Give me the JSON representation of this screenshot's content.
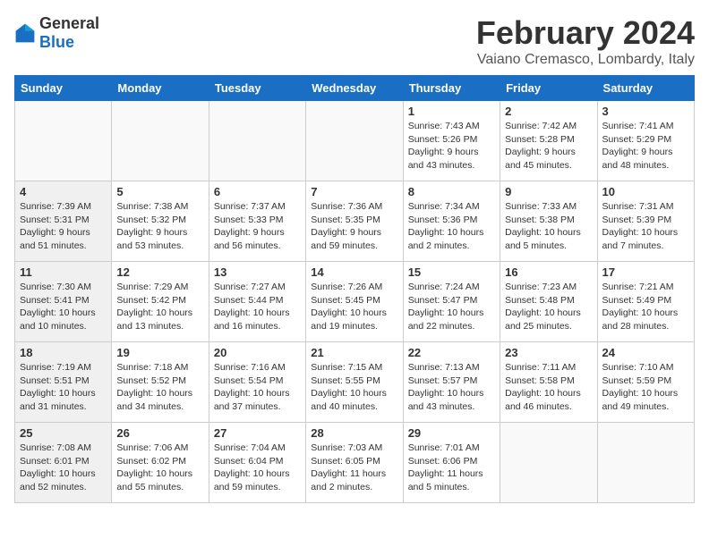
{
  "logo": {
    "text_general": "General",
    "text_blue": "Blue"
  },
  "header": {
    "title": "February 2024",
    "subtitle": "Vaiano Cremasco, Lombardy, Italy"
  },
  "weekdays": [
    "Sunday",
    "Monday",
    "Tuesday",
    "Wednesday",
    "Thursday",
    "Friday",
    "Saturday"
  ],
  "weeks": [
    [
      {
        "day": "",
        "info": "",
        "empty": true
      },
      {
        "day": "",
        "info": "",
        "empty": true
      },
      {
        "day": "",
        "info": "",
        "empty": true
      },
      {
        "day": "",
        "info": "",
        "empty": true
      },
      {
        "day": "1",
        "info": "Sunrise: 7:43 AM\nSunset: 5:26 PM\nDaylight: 9 hours\nand 43 minutes."
      },
      {
        "day": "2",
        "info": "Sunrise: 7:42 AM\nSunset: 5:28 PM\nDaylight: 9 hours\nand 45 minutes."
      },
      {
        "day": "3",
        "info": "Sunrise: 7:41 AM\nSunset: 5:29 PM\nDaylight: 9 hours\nand 48 minutes."
      }
    ],
    [
      {
        "day": "4",
        "info": "Sunrise: 7:39 AM\nSunset: 5:31 PM\nDaylight: 9 hours\nand 51 minutes.",
        "shaded": true
      },
      {
        "day": "5",
        "info": "Sunrise: 7:38 AM\nSunset: 5:32 PM\nDaylight: 9 hours\nand 53 minutes."
      },
      {
        "day": "6",
        "info": "Sunrise: 7:37 AM\nSunset: 5:33 PM\nDaylight: 9 hours\nand 56 minutes."
      },
      {
        "day": "7",
        "info": "Sunrise: 7:36 AM\nSunset: 5:35 PM\nDaylight: 9 hours\nand 59 minutes."
      },
      {
        "day": "8",
        "info": "Sunrise: 7:34 AM\nSunset: 5:36 PM\nDaylight: 10 hours\nand 2 minutes."
      },
      {
        "day": "9",
        "info": "Sunrise: 7:33 AM\nSunset: 5:38 PM\nDaylight: 10 hours\nand 5 minutes."
      },
      {
        "day": "10",
        "info": "Sunrise: 7:31 AM\nSunset: 5:39 PM\nDaylight: 10 hours\nand 7 minutes."
      }
    ],
    [
      {
        "day": "11",
        "info": "Sunrise: 7:30 AM\nSunset: 5:41 PM\nDaylight: 10 hours\nand 10 minutes.",
        "shaded": true
      },
      {
        "day": "12",
        "info": "Sunrise: 7:29 AM\nSunset: 5:42 PM\nDaylight: 10 hours\nand 13 minutes."
      },
      {
        "day": "13",
        "info": "Sunrise: 7:27 AM\nSunset: 5:44 PM\nDaylight: 10 hours\nand 16 minutes."
      },
      {
        "day": "14",
        "info": "Sunrise: 7:26 AM\nSunset: 5:45 PM\nDaylight: 10 hours\nand 19 minutes."
      },
      {
        "day": "15",
        "info": "Sunrise: 7:24 AM\nSunset: 5:47 PM\nDaylight: 10 hours\nand 22 minutes."
      },
      {
        "day": "16",
        "info": "Sunrise: 7:23 AM\nSunset: 5:48 PM\nDaylight: 10 hours\nand 25 minutes."
      },
      {
        "day": "17",
        "info": "Sunrise: 7:21 AM\nSunset: 5:49 PM\nDaylight: 10 hours\nand 28 minutes."
      }
    ],
    [
      {
        "day": "18",
        "info": "Sunrise: 7:19 AM\nSunset: 5:51 PM\nDaylight: 10 hours\nand 31 minutes.",
        "shaded": true
      },
      {
        "day": "19",
        "info": "Sunrise: 7:18 AM\nSunset: 5:52 PM\nDaylight: 10 hours\nand 34 minutes."
      },
      {
        "day": "20",
        "info": "Sunrise: 7:16 AM\nSunset: 5:54 PM\nDaylight: 10 hours\nand 37 minutes."
      },
      {
        "day": "21",
        "info": "Sunrise: 7:15 AM\nSunset: 5:55 PM\nDaylight: 10 hours\nand 40 minutes."
      },
      {
        "day": "22",
        "info": "Sunrise: 7:13 AM\nSunset: 5:57 PM\nDaylight: 10 hours\nand 43 minutes."
      },
      {
        "day": "23",
        "info": "Sunrise: 7:11 AM\nSunset: 5:58 PM\nDaylight: 10 hours\nand 46 minutes."
      },
      {
        "day": "24",
        "info": "Sunrise: 7:10 AM\nSunset: 5:59 PM\nDaylight: 10 hours\nand 49 minutes."
      }
    ],
    [
      {
        "day": "25",
        "info": "Sunrise: 7:08 AM\nSunset: 6:01 PM\nDaylight: 10 hours\nand 52 minutes.",
        "shaded": true
      },
      {
        "day": "26",
        "info": "Sunrise: 7:06 AM\nSunset: 6:02 PM\nDaylight: 10 hours\nand 55 minutes."
      },
      {
        "day": "27",
        "info": "Sunrise: 7:04 AM\nSunset: 6:04 PM\nDaylight: 10 hours\nand 59 minutes."
      },
      {
        "day": "28",
        "info": "Sunrise: 7:03 AM\nSunset: 6:05 PM\nDaylight: 11 hours\nand 2 minutes."
      },
      {
        "day": "29",
        "info": "Sunrise: 7:01 AM\nSunset: 6:06 PM\nDaylight: 11 hours\nand 5 minutes."
      },
      {
        "day": "",
        "info": "",
        "empty": true
      },
      {
        "day": "",
        "info": "",
        "empty": true
      }
    ]
  ]
}
